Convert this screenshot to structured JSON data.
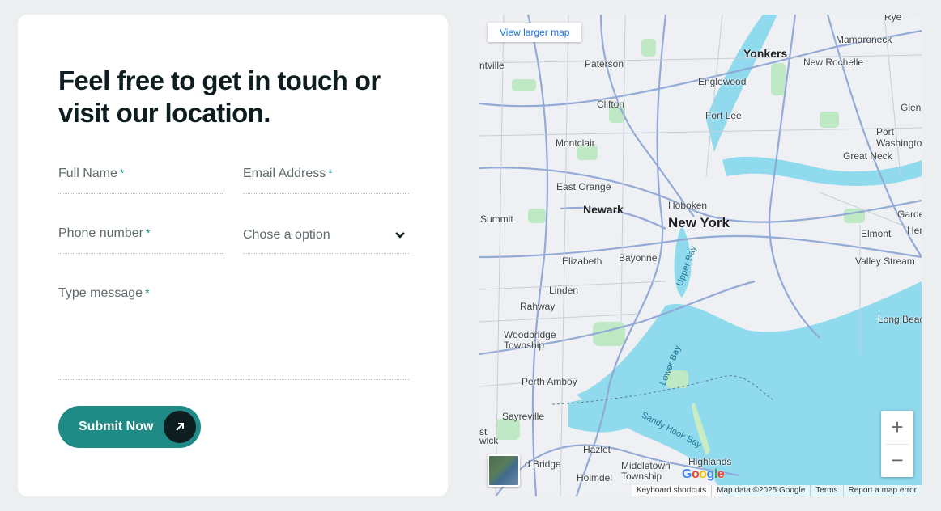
{
  "form": {
    "heading": "Feel free to get in touch or visit our location.",
    "full_name_label": "Full Name",
    "email_label": "Email Address",
    "phone_label": "Phone number",
    "select_label": "Chose a option",
    "message_label": "Type message",
    "required_mark": "*",
    "submit_label": "Submit Now"
  },
  "map": {
    "view_larger": "View larger map",
    "google_logo": "Google",
    "attribution": [
      "Keyboard shortcuts",
      "Map data ©2025 Google",
      "Terms",
      "Report a map error"
    ],
    "zoom_in": "+",
    "zoom_out": "−",
    "places": {
      "rye": "Rye",
      "mamaroneck": "Mamaroneck",
      "yonkers": "Yonkers",
      "new_rochelle": "New Rochelle",
      "paterson": "Paterson",
      "englewood": "Englewood",
      "clifton": "Clifton",
      "fort_lee": "Fort Lee",
      "glen": "Glen",
      "port_washington": "Port Washington",
      "great_neck": "Great Neck",
      "montclair": "Montclair",
      "east_orange": "East Orange",
      "hoboken": "Hoboken",
      "newark": "Newark",
      "new_york": "New York",
      "summit": "Summit",
      "elizabeth": "Elizabeth",
      "bayonne": "Bayonne",
      "elmont": "Elmont",
      "valley_stream": "Valley Stream",
      "linden": "Linden",
      "rahway": "Rahway",
      "woodbridge": "Woodbridge Township",
      "long_beach": "Long Beac",
      "perth_amboy": "Perth Amboy",
      "sayreville": "Sayreville",
      "hazlet": "Hazlet",
      "highlands": "Highlands",
      "middletown": "Middletown Township",
      "holmdel": "Holmdel",
      "wick": "wick",
      "st": "st",
      "ntville": "ntville",
      "ridge": "d Bridge",
      "garde": "Garde",
      "her": "Her",
      "upper_bay": "Upper Bay",
      "lower_bay": "Lower Bay",
      "sandy_hook_bay": "Sandy Hook Bay"
    }
  }
}
